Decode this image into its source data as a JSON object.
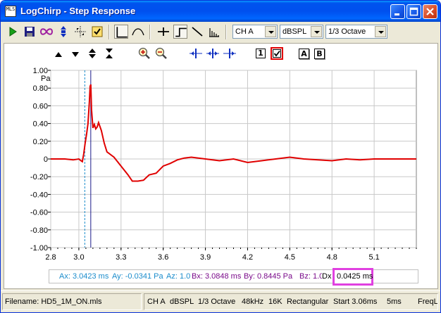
{
  "window": {
    "title": "LogChirp - Step Response",
    "app_icon_text": "MLS"
  },
  "toolbar": {
    "channel_select": "CH A",
    "unit_select": "dBSPL",
    "smoothing_select": "1/3 Octave"
  },
  "graph": {
    "y_unit": "Pa",
    "control_box_label": "1",
    "button_a": "A",
    "button_b": "B"
  },
  "chart_data": {
    "type": "line",
    "title": "",
    "xlabel": "",
    "ylabel": "Pa",
    "xlim": [
      2.8,
      5.4
    ],
    "ylim": [
      -1.0,
      1.0
    ],
    "x_ticks": [
      "2.8",
      "3.0",
      "3.3",
      "3.6",
      "3.9",
      "4.2",
      "4.5",
      "4.8",
      "5.1"
    ],
    "x_tick_values": [
      2.8,
      3.0,
      3.3,
      3.6,
      3.9,
      4.2,
      4.5,
      4.8,
      5.1
    ],
    "y_ticks": [
      "1.00",
      "0.80",
      "0.60",
      "0.40",
      "0.20",
      "0",
      "-0.20",
      "-0.40",
      "-0.60",
      "-0.80",
      "-1.00"
    ],
    "y_tick_values": [
      1.0,
      0.8,
      0.6,
      0.4,
      0.2,
      0,
      -0.2,
      -0.4,
      -0.6,
      -0.8,
      -1.0
    ],
    "grid": true,
    "line_color": "#e00000",
    "cursor_a_x": 3.0423,
    "cursor_b_x": 3.0848,
    "series": [
      {
        "x": [
          2.8,
          2.9,
          2.96,
          3.0,
          3.015,
          3.025,
          3.035,
          3.045,
          3.055,
          3.065,
          3.075,
          3.08,
          3.0848,
          3.09,
          3.1,
          3.11,
          3.12,
          3.13,
          3.14,
          3.16,
          3.18,
          3.2,
          3.25,
          3.3,
          3.35,
          3.38,
          3.42,
          3.46,
          3.5,
          3.55,
          3.6,
          3.65,
          3.7,
          3.75,
          3.8,
          3.9,
          4.0,
          4.1,
          4.2,
          4.3,
          4.4,
          4.5,
          4.6,
          4.7,
          4.8,
          4.9,
          5.0,
          5.1,
          5.2,
          5.3,
          5.4
        ],
        "y": [
          0.0,
          0.0,
          -0.01,
          0.0,
          -0.02,
          -0.03,
          0.06,
          0.18,
          0.28,
          0.4,
          0.65,
          0.82,
          0.84,
          0.56,
          0.35,
          0.39,
          0.34,
          0.36,
          0.41,
          0.32,
          0.18,
          0.08,
          0.02,
          -0.08,
          -0.18,
          -0.25,
          -0.25,
          -0.24,
          -0.18,
          -0.16,
          -0.08,
          -0.05,
          -0.01,
          0.01,
          0.02,
          0.0,
          -0.02,
          0.0,
          -0.04,
          -0.02,
          0.0,
          0.02,
          0.0,
          -0.01,
          -0.02,
          0.0,
          -0.01,
          0.0,
          0.0,
          0.0,
          0.0
        ]
      }
    ]
  },
  "readout": {
    "ax": "Ax: 3.0423 ms",
    "ay": "Ay: -0.0341 Pa",
    "az": "Az: 1.0",
    "bx": "Bx: 3.0848 ms",
    "by": "By: 0.8445 Pa",
    "bz": "Bz: 1.0",
    "dx_label": "Dx",
    "dx_value": "0.0425 ms"
  },
  "status": {
    "filename": "Filename: HD5_1M_ON.mls",
    "channel": "CH A",
    "unit": "dBSPL",
    "smoothing": "1/3 Octave",
    "rate": "48kHz",
    "length": "16K",
    "window": "Rectangular",
    "start": "Start 3.06ms",
    "duration": "5ms",
    "freq": "FreqL"
  },
  "colors": {
    "accent": "#0053ee",
    "readout_a": "#1a8ccc",
    "readout_b": "#7a0a8a",
    "highlight": "#e040e0",
    "trace": "#e00000"
  }
}
